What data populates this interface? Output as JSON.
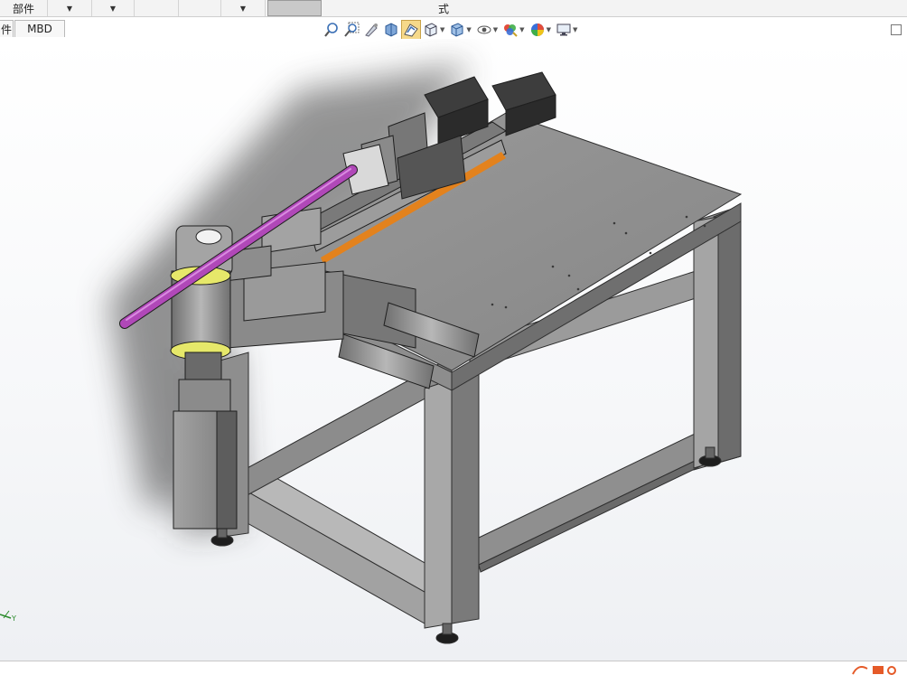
{
  "topbar": {
    "part_label": "部件",
    "mode_label": "式"
  },
  "tabs": {
    "partial_label": "件",
    "mbd_label": "MBD"
  },
  "hud": {
    "icons": [
      "zoom-to-fit-icon",
      "zoom-to-area-icon",
      "previous-view-icon",
      "section-view-icon",
      "view-selector-icon",
      "view-orientation-icon",
      "display-style-icon",
      "hide-show-items-icon",
      "edit-appearance-icon",
      "apply-scene-icon",
      "view-settings-icon"
    ],
    "active_icon": "view-selector-icon"
  },
  "colors": {
    "frame": "#8e8e8e",
    "table_top": "#8a8a8a",
    "tube": "#b048b8",
    "accent_orange": "#e3821d",
    "yellow_ring": "#e6e86a"
  }
}
